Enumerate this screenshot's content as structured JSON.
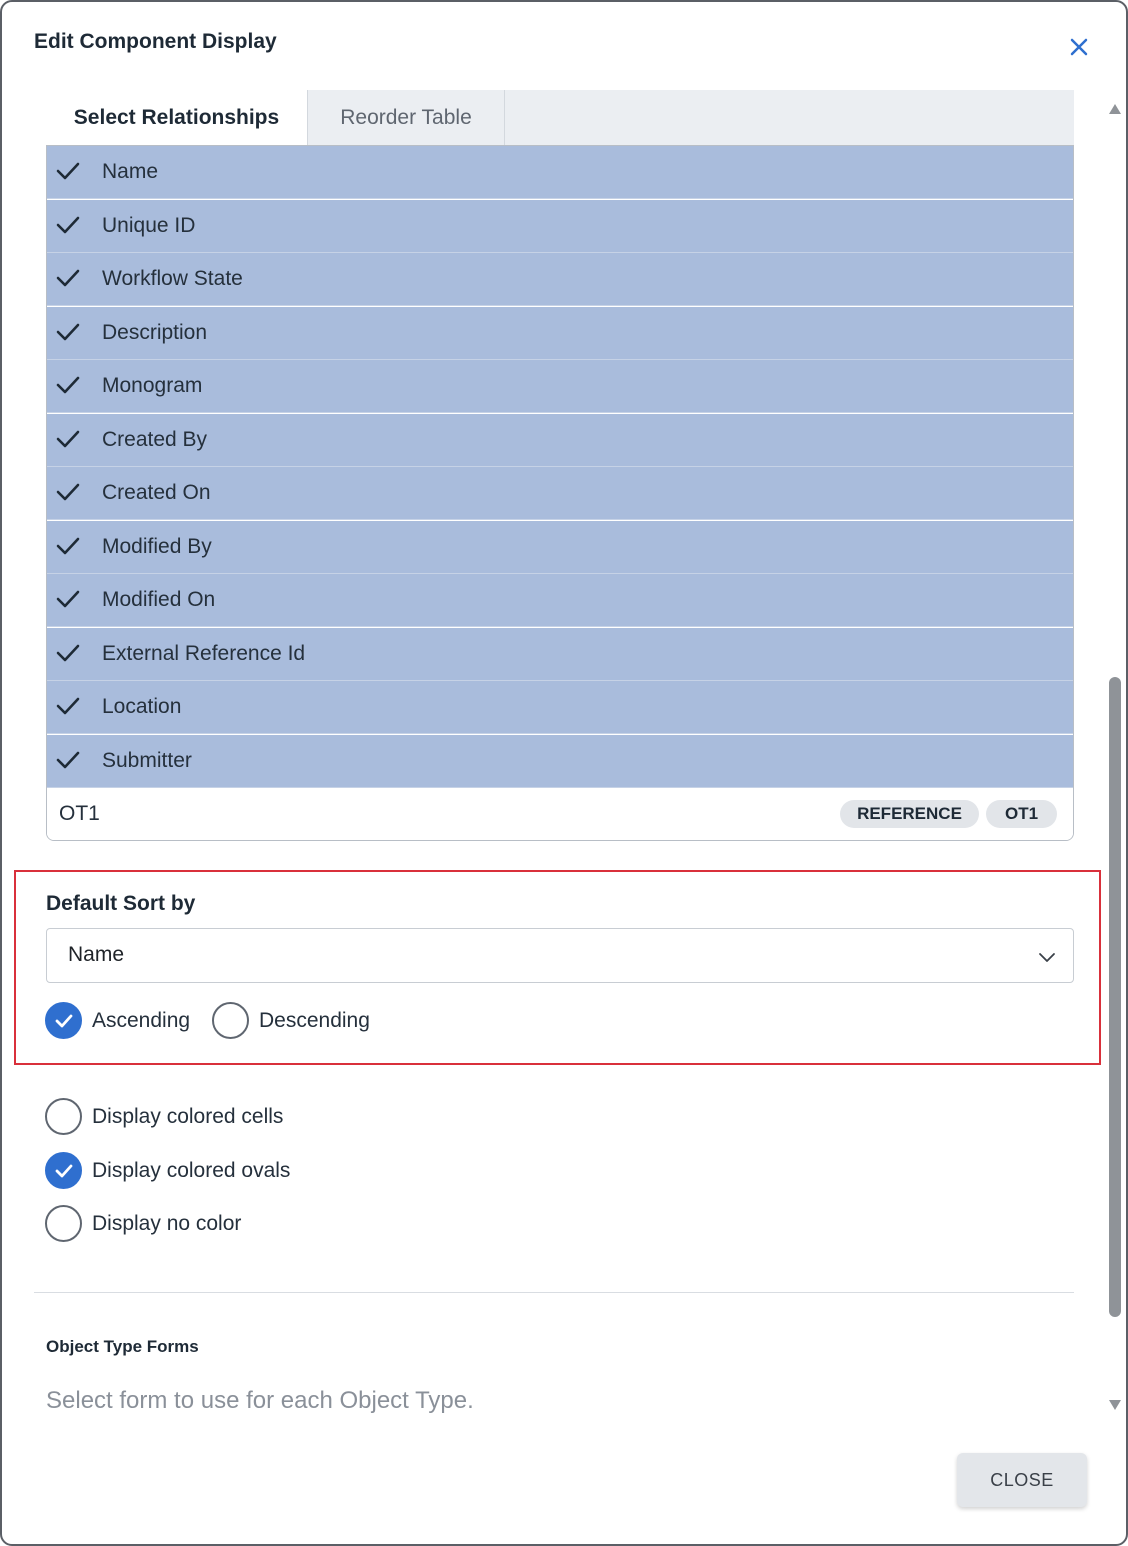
{
  "dialog": {
    "title": "Edit Component Display",
    "close_label": "CLOSE"
  },
  "tabs": [
    {
      "label": "Select Relationships",
      "active": true
    },
    {
      "label": "Reorder Table",
      "active": false
    }
  ],
  "relationships": {
    "items": [
      {
        "label": "Name",
        "checked": true
      },
      {
        "label": "Unique ID",
        "checked": true
      },
      {
        "label": "Workflow State",
        "checked": true
      },
      {
        "label": "Description",
        "checked": true
      },
      {
        "label": "Monogram",
        "checked": true
      },
      {
        "label": "Created By",
        "checked": true
      },
      {
        "label": "Created On",
        "checked": true
      },
      {
        "label": "Modified By",
        "checked": true
      },
      {
        "label": "Modified On",
        "checked": true
      },
      {
        "label": "External Reference Id",
        "checked": true
      },
      {
        "label": "Location",
        "checked": true
      },
      {
        "label": "Submitter",
        "checked": true
      }
    ],
    "object_type": {
      "label": "OT1",
      "badges": [
        "REFERENCE",
        "OT1"
      ]
    }
  },
  "sort": {
    "title": "Default Sort by",
    "selected": "Name",
    "ascending_label": "Ascending",
    "descending_label": "Descending",
    "direction": "Ascending"
  },
  "color_options": {
    "cells_label": "Display colored cells",
    "ovals_label": "Display colored ovals",
    "none_label": "Display no color",
    "selected": "Display colored ovals"
  },
  "forms": {
    "title": "Object Type Forms",
    "hint": "Select form to use for each Object Type."
  },
  "colors": {
    "selected_row": "#a9bcdc",
    "accent": "#2f6fcf",
    "highlight_border": "#d9303b"
  }
}
